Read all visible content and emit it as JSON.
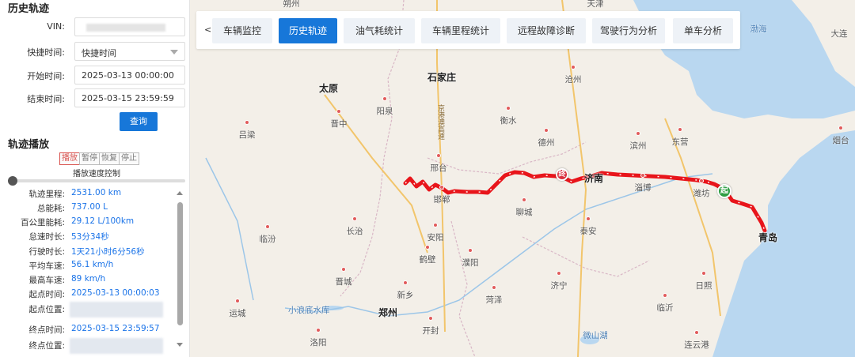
{
  "query": {
    "title": "历史轨迹",
    "vin_label": "VIN:",
    "quick_time_label": "快捷时间:",
    "quick_time_value": "快捷时间",
    "start_label": "开始时间:",
    "start_value": "2025-03-13 00:00:00",
    "end_label": "结束时间:",
    "end_value": "2025-03-15 23:59:59",
    "query_button": "查询"
  },
  "playback": {
    "title": "轨迹播放",
    "buttons": [
      "播放",
      "暂停",
      "恢复",
      "停止"
    ],
    "speed_label": "播放速度控制",
    "speed_level": 0
  },
  "stats": [
    {
      "label": "轨迹里程:",
      "value": "2531.00 km"
    },
    {
      "label": "总能耗:",
      "value": "737.00 L"
    },
    {
      "label": "百公里能耗:",
      "value": "29.12 L/100km"
    },
    {
      "label": "怠速时长:",
      "value": "53分34秒"
    },
    {
      "label": "行驶时长:",
      "value": "1天21小时6分56秒"
    },
    {
      "label": "平均车速:",
      "value": "56.1 km/h"
    },
    {
      "label": "最高车速:",
      "value": "89 km/h"
    },
    {
      "label": "起点时间:",
      "value": "2025-03-13 00:00:03"
    },
    {
      "label": "起点位置:",
      "value": ""
    },
    {
      "label": "终点时间:",
      "value": "2025-03-15 23:59:57"
    },
    {
      "label": "终点位置:",
      "value": ""
    }
  ],
  "tabs": {
    "back": "<",
    "items": [
      "车辆监控",
      "历史轨迹",
      "油气耗统计",
      "车辆里程统计",
      "远程故障诊断",
      "驾驶行为分析",
      "单车分析"
    ],
    "active": "历史轨迹"
  },
  "map": {
    "cities": [
      "太原",
      "石家庄",
      "郑州",
      "济南",
      "青岛"
    ],
    "places": [
      "朔州",
      "天津",
      "沧州",
      "阳泉",
      "晋中",
      "吕梁",
      "衡水",
      "德州",
      "滨州",
      "东营",
      "邢台",
      "烟台",
      "潍坊",
      "淄博",
      "邯郸",
      "聊城",
      "泰安",
      "长治",
      "安阳",
      "临汾",
      "鹤壁",
      "濮阳",
      "晋城",
      "新乡",
      "菏泽",
      "济宁",
      "日照",
      "临沂",
      "运城",
      "开封",
      "洛阳",
      "微山湖",
      "连云港",
      "小浪底水库",
      "渤海",
      "大连",
      "京港澳高速"
    ],
    "start_marker": "起",
    "end_marker": "终",
    "colors": {
      "track": "#e8151b",
      "start": "#2f9e44",
      "end": "#d9303f",
      "sea": "#b9d7f0",
      "land": "#f3efe8",
      "province_border": "#d9b7c6",
      "highway": "#f2c56b"
    }
  }
}
